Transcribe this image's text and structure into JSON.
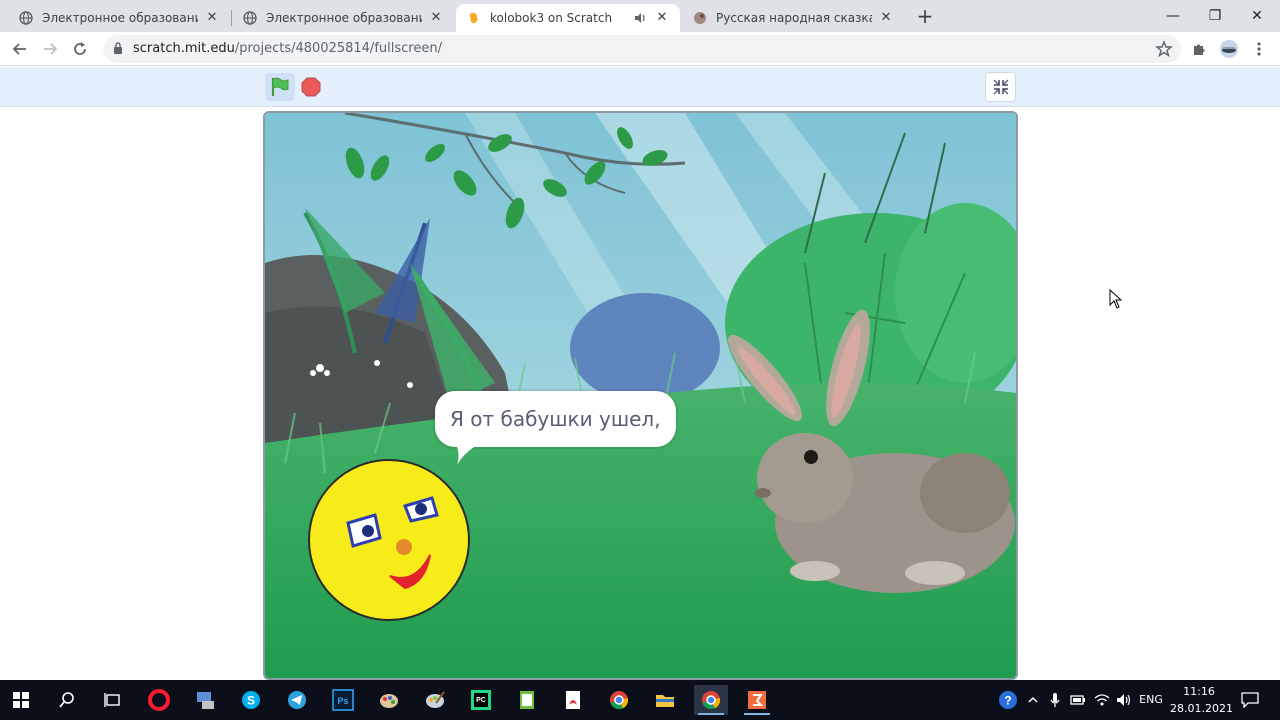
{
  "tabs": [
    {
      "title": "Электронное образование Рес",
      "close": "✕",
      "active": false
    },
    {
      "title": "Электронное образование Рес",
      "close": "✕",
      "active": false
    },
    {
      "title": "kolobok3 on Scratch",
      "close": "✕",
      "active": true
    },
    {
      "title": "Русская народная сказка - Коло",
      "close": "✕",
      "active": false
    }
  ],
  "new_tab": "+",
  "window_controls": {
    "minimize": "—",
    "maximize": "❐",
    "close": "✕"
  },
  "address": {
    "host": "scratch.mit.edu",
    "path": "/projects/480025814/fullscreen/"
  },
  "stage": {
    "speech": "Я от бабушки ушел,"
  },
  "icons": {
    "back": "arrow-left-icon",
    "forward": "arrow-right-icon",
    "reload": "reload-icon",
    "lock": "lock-icon",
    "bookmark": "star-icon",
    "extensions": "puzzle-icon",
    "profile": "avatar-icon",
    "menu": "kebab-menu-icon",
    "green_flag": "green-flag-icon",
    "stop": "stop-icon",
    "exit_fullscreen": "shrink-icon"
  },
  "taskbar": {
    "lang": "ENG",
    "time": "11:16",
    "date": "28.01.2021"
  },
  "colors": {
    "flag": "#4cbf56",
    "stop": "#ec5959",
    "bubble_text": "#575e75"
  }
}
